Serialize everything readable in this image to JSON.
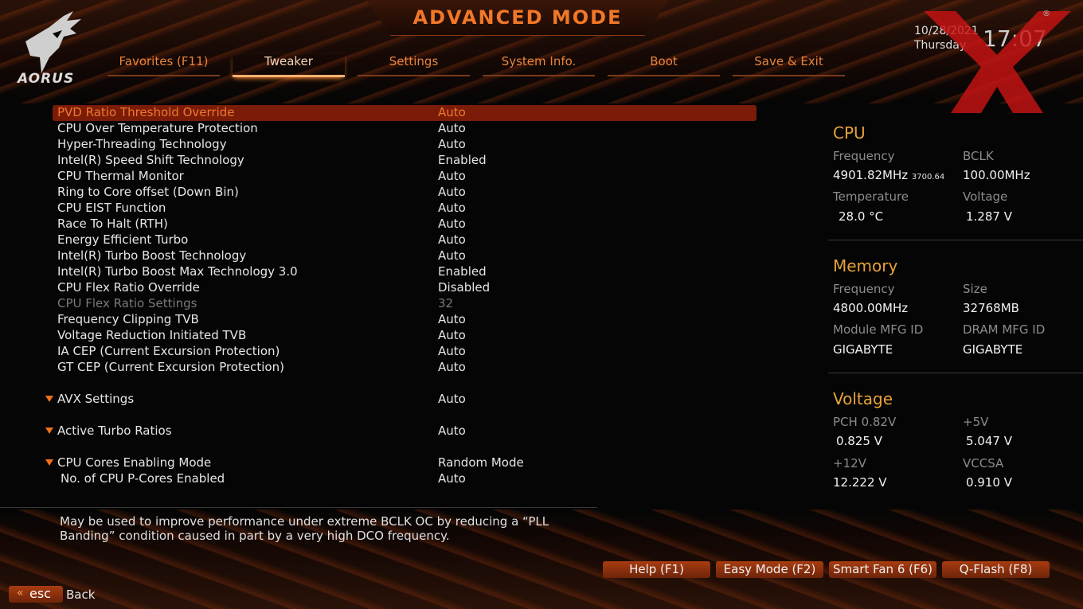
{
  "header": {
    "title": "ADVANCED MODE",
    "logo_text": "AORUS",
    "date": "10/28/2021",
    "day": "Thursday",
    "time": "17:07"
  },
  "tabs": [
    {
      "label": "Favorites (F11)",
      "active": false
    },
    {
      "label": "Tweaker",
      "active": true
    },
    {
      "label": "Settings",
      "active": false
    },
    {
      "label": "System Info.",
      "active": false
    },
    {
      "label": "Boot",
      "active": false
    },
    {
      "label": "Save & Exit",
      "active": false
    }
  ],
  "settings": [
    {
      "label": "PVD Ratio Threshold Override",
      "value": "Auto",
      "state": "selected"
    },
    {
      "label": "CPU Over Temperature Protection",
      "value": "Auto"
    },
    {
      "label": "Hyper-Threading Technology",
      "value": "Auto"
    },
    {
      "label": "Intel(R) Speed Shift Technology",
      "value": "Enabled"
    },
    {
      "label": "CPU Thermal Monitor",
      "value": "Auto"
    },
    {
      "label": "Ring to Core offset (Down Bin)",
      "value": "Auto"
    },
    {
      "label": "CPU EIST Function",
      "value": "Auto"
    },
    {
      "label": "Race To Halt (RTH)",
      "value": "Auto"
    },
    {
      "label": "Energy Efficient Turbo",
      "value": "Auto"
    },
    {
      "label": "Intel(R) Turbo Boost Technology",
      "value": "Auto"
    },
    {
      "label": "Intel(R) Turbo Boost Max Technology 3.0",
      "value": "Enabled"
    },
    {
      "label": "CPU Flex Ratio Override",
      "value": "Disabled"
    },
    {
      "label": "CPU Flex Ratio Settings",
      "value": "32",
      "state": "disabled"
    },
    {
      "label": "Frequency Clipping TVB",
      "value": "Auto"
    },
    {
      "label": "Voltage Reduction Initiated TVB",
      "value": "Auto"
    },
    {
      "label": "IA CEP (Current Excursion Protection)",
      "value": "Auto"
    },
    {
      "label": "GT CEP (Current Excursion Protection)",
      "value": "Auto"
    },
    {
      "label": "AVX Settings",
      "value": "Auto",
      "submenu": true
    },
    {
      "label": "Active Turbo Ratios",
      "value": "Auto",
      "submenu": true
    },
    {
      "label": "CPU Cores Enabling Mode",
      "value": "Random Mode",
      "submenu": true
    },
    {
      "label": "No. of CPU P-Cores Enabled",
      "value": "Auto"
    }
  ],
  "help_text": "May be used to improve performance under extreme BCLK OC by reducing a “PLL Banding” condition caused in part by a very high DCO frequency.",
  "cpu": {
    "title": "CPU",
    "freq_label": "Frequency",
    "freq_value": "4901.82MHz",
    "freq_small": "3700.64",
    "bclk_label": "BCLK",
    "bclk_value": "100.00MHz",
    "temp_label": "Temperature",
    "temp_value": "28.0 °C",
    "volt_label": "Voltage",
    "volt_value": "1.287 V"
  },
  "memory": {
    "title": "Memory",
    "freq_label": "Frequency",
    "freq_value": "4800.00MHz",
    "size_label": "Size",
    "size_value": "32768MB",
    "module_label": "Module MFG ID",
    "module_value": "GIGABYTE",
    "dram_label": "DRAM MFG ID",
    "dram_value": "GIGABYTE"
  },
  "voltage": {
    "title": "Voltage",
    "pch_label": "PCH 0.82V",
    "pch_value": "0.825 V",
    "p5v_label": "+5V",
    "p5v_value": "5.047 V",
    "p12v_label": "+12V",
    "p12v_value": "12.222 V",
    "vccsa_label": "VCCSA",
    "vccsa_value": "0.910 V"
  },
  "footer": {
    "buttons": [
      "Help (F1)",
      "Easy Mode (F2)",
      "Smart Fan 6 (F6)",
      "Q-Flash (F8)"
    ],
    "esc_label": "esc",
    "back_label": "Back"
  }
}
